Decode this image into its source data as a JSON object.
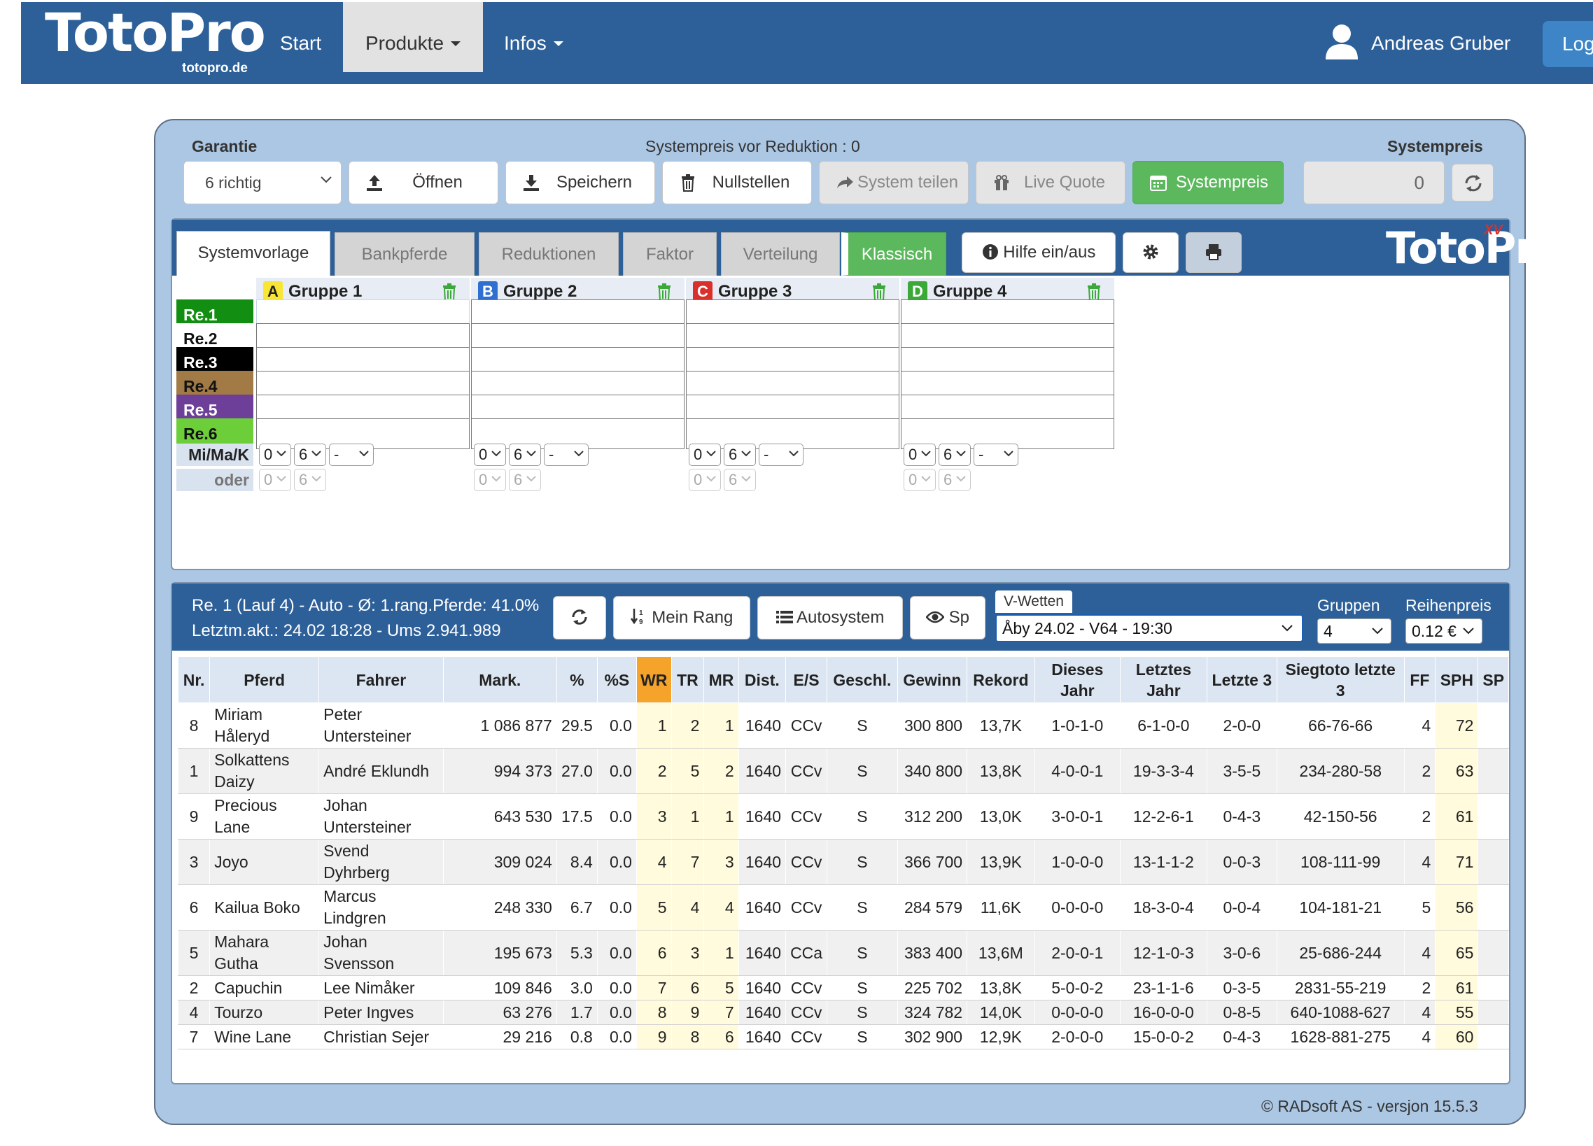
{
  "navbar": {
    "brand": "TotoPro",
    "brand_sub": "totopro.de",
    "items": [
      "Start",
      "Produkte",
      "Infos"
    ],
    "user": "Andreas Gruber",
    "login": "Logout"
  },
  "toolbar": {
    "garantie_label": "Garantie",
    "garantie_value": "6 richtig",
    "systempreis_vor": "Systempreis vor Reduktion : 0",
    "systempreis_label": "Systempreis",
    "systempreis_value": "0",
    "buttons": {
      "open": "Öffnen",
      "save": "Speichern",
      "reset": "Nullstellen",
      "share": "System teilen",
      "live": "Live Quote",
      "price": "Systempreis"
    }
  },
  "system": {
    "tabs": [
      "Systemvorlage",
      "Bankpferde",
      "Reduktionen",
      "Faktor",
      "Verteilung",
      "Klassisch"
    ],
    "help": "Hilfe ein/aus",
    "logo": "TotoPro",
    "logo_badge": "XV",
    "groups": [
      {
        "letter": "A",
        "title": "Gruppe 1",
        "color": "#f9e534"
      },
      {
        "letter": "B",
        "title": "Gruppe 2",
        "color": "#2f6fd1"
      },
      {
        "letter": "C",
        "title": "Gruppe 3",
        "color": "#d9302c"
      },
      {
        "letter": "D",
        "title": "Gruppe 4",
        "color": "#3aa938"
      }
    ],
    "rows": [
      {
        "label": "Re.1",
        "bg": "#128f12",
        "fg": "#ffffff"
      },
      {
        "label": "Re.2",
        "bg": "#ffffff",
        "fg": "#111111"
      },
      {
        "label": "Re.3",
        "bg": "#000000",
        "fg": "#ffffff"
      },
      {
        "label": "Re.4",
        "bg": "#a27a45",
        "fg": "#111111"
      },
      {
        "label": "Re.5",
        "bg": "#6e3f98",
        "fg": "#ffffff"
      },
      {
        "label": "Re.6",
        "bg": "#6ccf3a",
        "fg": "#111111"
      }
    ],
    "mimak_label": "Mi/Ma/K",
    "oder_label": "oder",
    "mimak_values": [
      "0",
      "6",
      "-"
    ],
    "oder_values": [
      "0",
      "6"
    ]
  },
  "race": {
    "info_line1": "Re. 1 (Lauf 4) - Auto - Ø: 1.rang.Pferde: 41.0%",
    "info_line2": "Letztm.akt.: 24.02 18:28 - Ums 2.941.989",
    "buttons": {
      "rank": "Mein Rang",
      "auto": "Autosystem",
      "sp": "Sp"
    },
    "vwetten_label": "V-Wetten",
    "vwetten_value": "Åby 24.02 - V64 - 19:30",
    "gruppen_label": "Gruppen",
    "gruppen_value": "4",
    "reihenpreis_label": "Reihenpreis",
    "reihenpreis_value": "0.12 €",
    "columns": [
      "Nr.",
      "Pferd",
      "Fahrer",
      "Mark.",
      "%",
      "%S",
      "WR",
      "TR",
      "MR",
      "Dist.",
      "E/S",
      "Geschl.",
      "Gewinn",
      "Rekord",
      "Dieses Jahr",
      "Letztes Jahr",
      "Letzte 3",
      "Siegtoto letzte 3",
      "FF",
      "SPH",
      "SP"
    ],
    "horses": [
      [
        "8",
        "Miriam Håleryd",
        "Peter Untersteiner",
        "1 086 877",
        "29.5",
        "0.0",
        "1",
        "2",
        "1",
        "1640",
        "CCv",
        "S",
        "300 800",
        "13,7K",
        "1-0-1-0",
        "6-1-0-0",
        "2-0-0",
        "66-76-66",
        "4",
        "72",
        ""
      ],
      [
        "1",
        "Solkattens Daizy",
        "André Eklundh",
        "994 373",
        "27.0",
        "0.0",
        "2",
        "5",
        "2",
        "1640",
        "CCv",
        "S",
        "340 800",
        "13,8K",
        "4-0-0-1",
        "19-3-3-4",
        "3-5-5",
        "234-280-58",
        "2",
        "63",
        ""
      ],
      [
        "9",
        "Precious Lane",
        "Johan Untersteiner",
        "643 530",
        "17.5",
        "0.0",
        "3",
        "1",
        "1",
        "1640",
        "CCv",
        "S",
        "312 200",
        "13,0K",
        "3-0-0-1",
        "12-2-6-1",
        "0-4-3",
        "42-150-56",
        "2",
        "61",
        ""
      ],
      [
        "3",
        "Joyo",
        "Svend Dyhrberg",
        "309 024",
        "8.4",
        "0.0",
        "4",
        "7",
        "3",
        "1640",
        "CCv",
        "S",
        "366 700",
        "13,9K",
        "1-0-0-0",
        "13-1-1-2",
        "0-0-3",
        "108-111-99",
        "4",
        "71",
        ""
      ],
      [
        "6",
        "Kailua Boko",
        "Marcus Lindgren",
        "248 330",
        "6.7",
        "0.0",
        "5",
        "4",
        "4",
        "1640",
        "CCv",
        "S",
        "284 579",
        "11,6K",
        "0-0-0-0",
        "18-3-0-4",
        "0-0-4",
        "104-181-21",
        "5",
        "56",
        ""
      ],
      [
        "5",
        "Mahara Gutha",
        "Johan Svensson",
        "195 673",
        "5.3",
        "0.0",
        "6",
        "3",
        "1",
        "1640",
        "CCa",
        "S",
        "383 400",
        "13,6M",
        "2-0-0-1",
        "12-1-0-3",
        "3-0-6",
        "25-686-244",
        "4",
        "65",
        ""
      ],
      [
        "2",
        "Capuchin",
        "Lee Nimåker",
        "109 846",
        "3.0",
        "0.0",
        "7",
        "6",
        "5",
        "1640",
        "CCv",
        "S",
        "225 702",
        "13,8K",
        "5-0-0-2",
        "23-1-1-6",
        "0-3-5",
        "2831-55-219",
        "2",
        "61",
        ""
      ],
      [
        "4",
        "Tourzo",
        "Peter Ingves",
        "63 276",
        "1.7",
        "0.0",
        "8",
        "9",
        "7",
        "1640",
        "CCv",
        "S",
        "324 782",
        "14,0K",
        "0-0-0-0",
        "16-0-0-0",
        "0-8-5",
        "640-1088-627",
        "4",
        "55",
        ""
      ],
      [
        "7",
        "Wine Lane",
        "Christian Sejer",
        "29 216",
        "0.8",
        "0.0",
        "9",
        "8",
        "6",
        "1640",
        "CCv",
        "S",
        "302 900",
        "12,9K",
        "2-0-0-0",
        "15-0-0-2",
        "0-4-3",
        "1628-881-275",
        "4",
        "60",
        ""
      ]
    ]
  },
  "footer": "© RADsoft AS - versjon 15.5.3",
  "colors": {
    "nav": "#2d6099",
    "panel": "#abc7e4",
    "green": "#5cb85c",
    "wr_header": "#f5a32a",
    "highlight": "#fffbdc"
  }
}
